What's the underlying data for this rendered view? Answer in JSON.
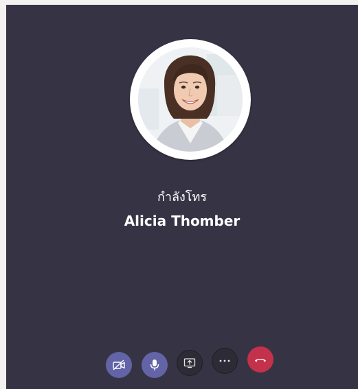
{
  "call": {
    "status": "กำลังโทร",
    "caller_name": "Alicia Thomber"
  },
  "controls": {
    "video_off": "camera-off-icon",
    "microphone": "microphone-icon",
    "share_screen": "share-screen-icon",
    "more_options": "more-options-icon",
    "hang_up": "hang-up-icon"
  },
  "colors": {
    "background": "#363444",
    "accent": "#6264a7",
    "hangup": "#c4314b",
    "text": "#ffffff"
  }
}
